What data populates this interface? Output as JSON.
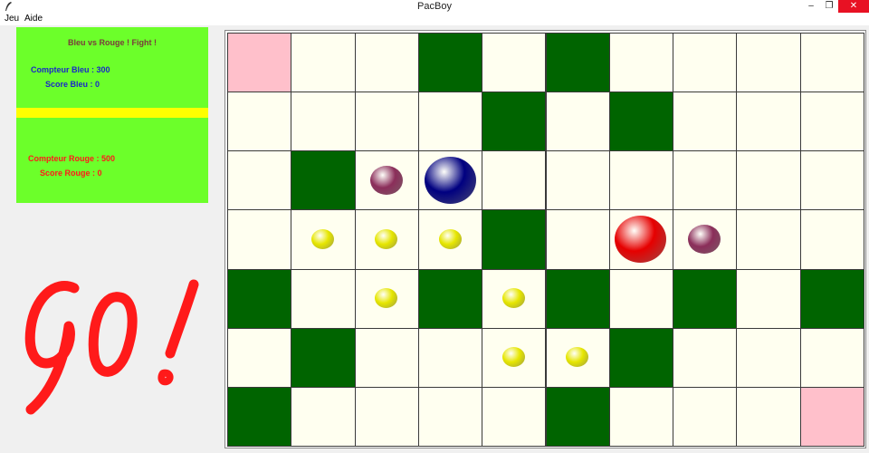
{
  "window": {
    "title": "PacBoy",
    "minimize_glyph": "–",
    "maximize_glyph": "❐",
    "close_glyph": "✕"
  },
  "menu": [
    "Jeu",
    "Aide"
  ],
  "panel": {
    "title": "Bleu vs Rouge ! Fight !",
    "blue_counter": "Compteur Bleu : 300",
    "blue_score": "Score Bleu : 0",
    "red_counter": "Compteur Rouge : 500",
    "red_score": "Score Rouge  : 0"
  },
  "go_text": "GO!",
  "colors": {
    "panel_bg": "#6cff2a",
    "divider": "#ffff00",
    "wall": "#006400",
    "floor": "#fffff0",
    "corner": "#ffc0cb",
    "pellet": "#e6e600",
    "bonus": "#8b2e5a",
    "blue_player": "#000080",
    "red_player": "#e60000"
  },
  "board": {
    "rows": 7,
    "cols": 10,
    "grid": [
      "C..W.W....",
      "....W.W...",
      ".W........",
      "....W.....",
      "W..W.W.W.W",
      ".W....W...",
      "W....W...C"
    ],
    "pellets": [
      [
        3,
        1
      ],
      [
        3,
        2
      ],
      [
        3,
        3
      ],
      [
        4,
        2
      ],
      [
        4,
        4
      ],
      [
        5,
        4
      ],
      [
        5,
        5
      ]
    ],
    "bonuses": [
      [
        2,
        2
      ],
      [
        3,
        7
      ]
    ],
    "players": [
      {
        "name": "blue",
        "row": 2,
        "col": 3
      },
      {
        "name": "red",
        "row": 3,
        "col": 6
      }
    ]
  }
}
